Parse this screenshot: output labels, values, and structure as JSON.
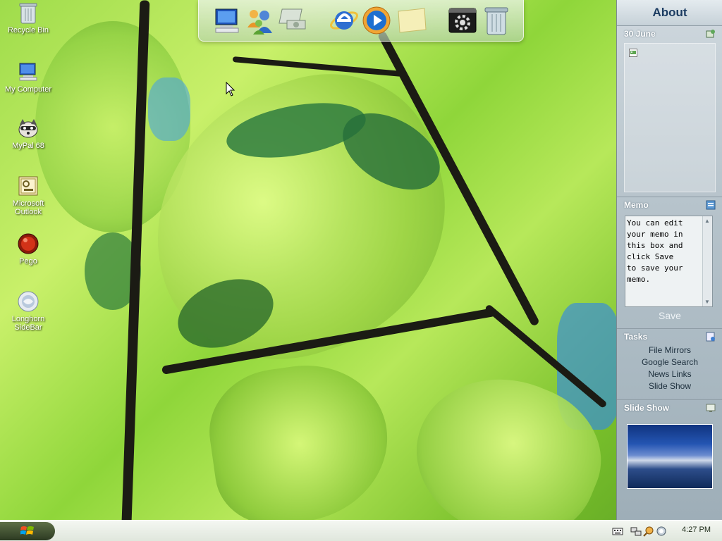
{
  "desktop_icons": [
    {
      "label": "Recycle Bin"
    },
    {
      "label": "My Computer"
    },
    {
      "label": "MyPal 68"
    },
    {
      "label": "Microsoft Outlook"
    },
    {
      "label": "Pego"
    },
    {
      "label": "Longhorn SideBar"
    }
  ],
  "dock": {
    "items": [
      {
        "icon": "my-computer-icon"
      },
      {
        "icon": "users-icon"
      },
      {
        "icon": "network-icon"
      },
      {
        "icon": "internet-explorer-icon"
      },
      {
        "icon": "media-player-icon"
      },
      {
        "icon": "sticky-note-icon"
      },
      {
        "icon": "settings-icon"
      },
      {
        "icon": "recycle-bin-icon"
      }
    ]
  },
  "sidebar": {
    "about": "About",
    "calendar": {
      "date": "30 June"
    },
    "memo": {
      "title": "Memo",
      "text": "You can edit\nyour memo in\nthis box and\nclick Save\nto save your\nmemo.",
      "save_label": "Save"
    },
    "tasks": {
      "title": "Tasks",
      "items": [
        "File Mirrors",
        "Google Search",
        "News Links",
        "Slide Show"
      ]
    },
    "slideshow": {
      "title": "Slide Show"
    }
  },
  "taskbar": {
    "clock": "4:27 PM"
  },
  "colors": {
    "sidebar_title": "#1c3c62",
    "taskbar": "#e9eee6",
    "wallpaper_green": "#9fdc4b"
  }
}
